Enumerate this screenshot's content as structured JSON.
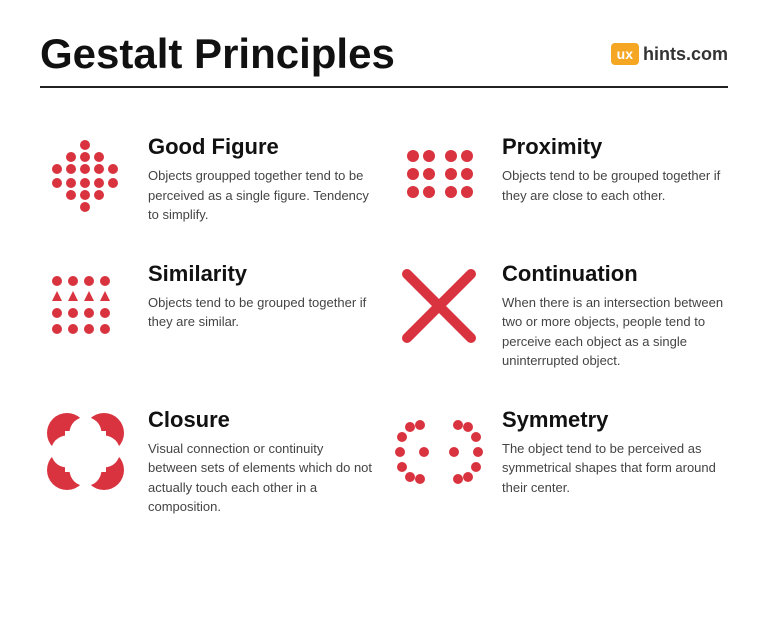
{
  "page": {
    "title": "Gestalt Principles",
    "logo_ux": "ux",
    "logo_domain": "hints.com"
  },
  "principles": [
    {
      "id": "good-figure",
      "title": "Good Figure",
      "description": "Objects groupped together tend to be perceived as a single figure. Tendency to simplify.",
      "icon_type": "diamond-dots"
    },
    {
      "id": "proximity",
      "title": "Proximity",
      "description": "Objects tend to be grouped together if they are close to each other.",
      "icon_type": "proximity-dots"
    },
    {
      "id": "similarity",
      "title": "Similarity",
      "description": "Objects tend to be grouped together if they are similar.",
      "icon_type": "similarity-dots"
    },
    {
      "id": "continuation",
      "title": "Continuation",
      "description": "When there is an intersection between two or more objects, people tend to perceive each object as a single uninterrupted object.",
      "icon_type": "x-cross"
    },
    {
      "id": "closure",
      "title": "Closure",
      "description": "Visual connection or continuity between sets of elements which do not actually touch each other in a composition.",
      "icon_type": "closure"
    },
    {
      "id": "symmetry",
      "title": "Symmetry",
      "description": "The object tend to be perceived as symmetrical shapes that form around their center.",
      "icon_type": "symmetry"
    }
  ]
}
